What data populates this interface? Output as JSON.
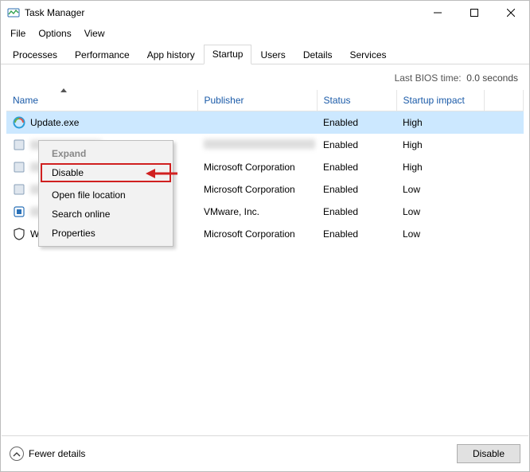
{
  "window": {
    "title": "Task Manager"
  },
  "menubar": {
    "file": "File",
    "options": "Options",
    "view": "View"
  },
  "tabs": {
    "processes": "Processes",
    "performance": "Performance",
    "app_history": "App history",
    "startup": "Startup",
    "users": "Users",
    "details": "Details",
    "services": "Services"
  },
  "bios": {
    "label": "Last BIOS time:",
    "value": "0.0 seconds"
  },
  "columns": {
    "name": "Name",
    "publisher": "Publisher",
    "status": "Status",
    "impact": "Startup impact"
  },
  "rows": [
    {
      "icon": "update-icon",
      "name": "Update.exe",
      "publisher": "",
      "status": "Enabled",
      "impact": "High",
      "name_blurred": false,
      "pub_blurred": false,
      "selected": true
    },
    {
      "icon": "generic-icon",
      "name": "",
      "publisher": "",
      "status": "Enabled",
      "impact": "High",
      "name_blurred": true,
      "pub_blurred": true,
      "selected": false
    },
    {
      "icon": "generic-icon",
      "name": "",
      "publisher": "Microsoft Corporation",
      "status": "Enabled",
      "impact": "High",
      "name_blurred": true,
      "pub_blurred": false,
      "selected": false
    },
    {
      "icon": "generic-icon",
      "name": "",
      "publisher": "Microsoft Corporation",
      "status": "Enabled",
      "impact": "Low",
      "name_blurred": true,
      "pub_blurred": false,
      "selected": false
    },
    {
      "icon": "vmware-icon",
      "name": "",
      "publisher": "VMware, Inc.",
      "status": "Enabled",
      "impact": "Low",
      "name_blurred": true,
      "pub_blurred": false,
      "selected": false
    },
    {
      "icon": "shield-icon",
      "name": "Windows Security notificati...",
      "publisher": "Microsoft Corporation",
      "status": "Enabled",
      "impact": "Low",
      "name_blurred": false,
      "pub_blurred": false,
      "selected": false
    }
  ],
  "context_menu": {
    "expand": "Expand",
    "disable": "Disable",
    "open_location": "Open file location",
    "search_online": "Search online",
    "properties": "Properties"
  },
  "footer": {
    "fewer_details": "Fewer details",
    "disable_btn": "Disable"
  }
}
